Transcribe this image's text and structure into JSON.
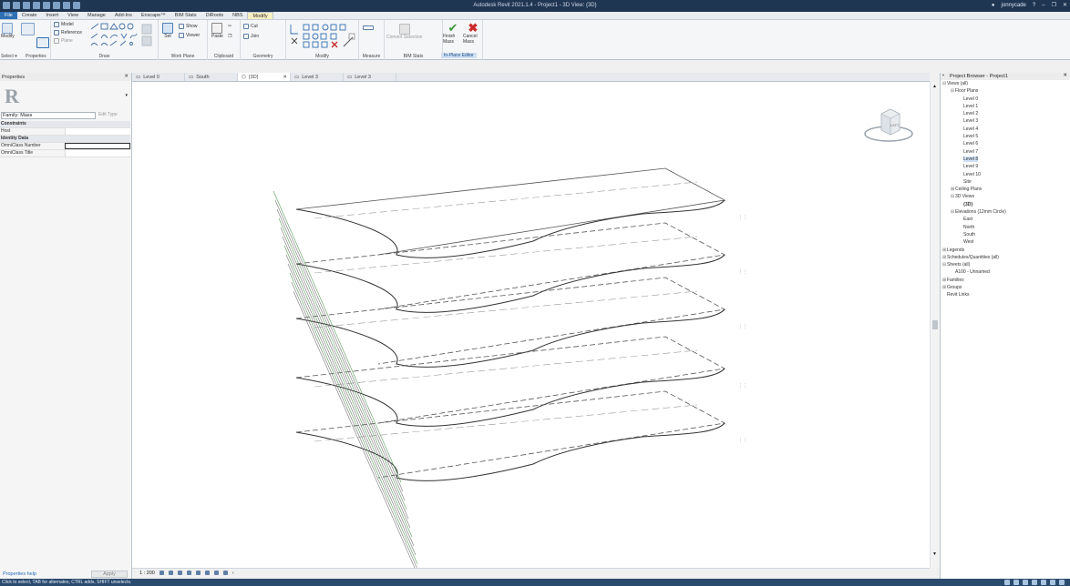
{
  "title_bar": {
    "title": "Autodesk Revit 2021.1.4 - Project1 - 3D View: {3D}",
    "user": "jonnycade"
  },
  "ribbon_tabs": [
    "File",
    "Create",
    "Insert",
    "View",
    "Manage",
    "Add-Ins",
    "Enscape™",
    "BIM Stats",
    "DiRoots",
    "NBS",
    "Modify"
  ],
  "ribbon": {
    "modify_label": "Modify",
    "select_label": "Select ▾",
    "properties_label": "Properties",
    "model_label": "Model",
    "reference_label": "Reference",
    "plane_label": "Plane",
    "draw_label": "Draw",
    "set_label": "Set",
    "show_label": "Show",
    "viewer_label": "Viewer",
    "work_plane_label": "Work Plane",
    "paste_label": "Paste",
    "clipboard_label": "Clipboard",
    "join_label": "Join",
    "cut_label": "Cut",
    "geometry_label": "Geometry",
    "modify_panel_label": "Modify",
    "measure_label": "Measure",
    "bim_stats_label": "BIM Stats",
    "convert_selection_label": "Convert Selection",
    "finish_mass_label": "Finish Mass",
    "cancel_mass_label": "Cancel Mass",
    "in_place_editor_label": "In-Place Editor"
  },
  "view_tabs": [
    {
      "label": "Level 0"
    },
    {
      "label": "South"
    },
    {
      "label": "{3D}"
    },
    {
      "label": "Level 3"
    },
    {
      "label": "Level 3"
    }
  ],
  "properties": {
    "title": "Properties",
    "family_label": "Family: Mass",
    "edit_type": "Edit Type",
    "rows": [
      {
        "k": "Constraints",
        "v": "",
        "group": true
      },
      {
        "k": "Host",
        "v": "",
        "group": false
      },
      {
        "k": "Identity Data",
        "v": "",
        "group": true
      },
      {
        "k": "OmniClass Number",
        "v": "",
        "group": false
      },
      {
        "k": "OmniClass Title",
        "v": "",
        "group": false
      }
    ],
    "help_link": "Properties help",
    "apply": "Apply"
  },
  "view_control": {
    "scale": "1 : 200"
  },
  "viewcube": {
    "face": "LEFT"
  },
  "project_browser": {
    "title": "Project Browser - Project1",
    "nodes": [
      {
        "label": "Views (all)",
        "indent": 0,
        "expander": "⊟"
      },
      {
        "label": "Floor Plans",
        "indent": 1,
        "expander": "⊟"
      },
      {
        "label": "Level 0",
        "indent": 2,
        "expander": ""
      },
      {
        "label": "Level 1",
        "indent": 2,
        "expander": ""
      },
      {
        "label": "Level 2",
        "indent": 2,
        "expander": ""
      },
      {
        "label": "Level 3",
        "indent": 2,
        "expander": ""
      },
      {
        "label": "Level 4",
        "indent": 2,
        "expander": ""
      },
      {
        "label": "Level 5",
        "indent": 2,
        "expander": ""
      },
      {
        "label": "Level 6",
        "indent": 2,
        "expander": ""
      },
      {
        "label": "Level 7",
        "indent": 2,
        "expander": ""
      },
      {
        "label": "Level 8",
        "indent": 2,
        "expander": "",
        "selected": true
      },
      {
        "label": "Level 9",
        "indent": 2,
        "expander": ""
      },
      {
        "label": "Level 10",
        "indent": 2,
        "expander": ""
      },
      {
        "label": "Site",
        "indent": 2,
        "expander": ""
      },
      {
        "label": "Ceiling Plans",
        "indent": 1,
        "expander": "⊞"
      },
      {
        "label": "3D Views",
        "indent": 1,
        "expander": "⊟"
      },
      {
        "label": "{3D}",
        "indent": 2,
        "expander": "",
        "bold": true
      },
      {
        "label": "Elevations (12mm Circle)",
        "indent": 1,
        "expander": "⊟"
      },
      {
        "label": "East",
        "indent": 2,
        "expander": ""
      },
      {
        "label": "North",
        "indent": 2,
        "expander": ""
      },
      {
        "label": "South",
        "indent": 2,
        "expander": ""
      },
      {
        "label": "West",
        "indent": 2,
        "expander": ""
      },
      {
        "label": "Legends",
        "indent": 0,
        "expander": "⊞"
      },
      {
        "label": "Schedules/Quantities (all)",
        "indent": 0,
        "expander": "⊞"
      },
      {
        "label": "Sheets (all)",
        "indent": 0,
        "expander": "⊟"
      },
      {
        "label": "A100 - Unnamed",
        "indent": 1,
        "expander": ""
      },
      {
        "label": "Families",
        "indent": 0,
        "expander": "⊞"
      },
      {
        "label": "Groups",
        "indent": 0,
        "expander": "⊞"
      },
      {
        "label": "Revit Links",
        "indent": 0,
        "expander": ""
      }
    ]
  },
  "status_bar": {
    "text": "Click to select, TAB for alternates, CTRL adds, SHIFT unselects."
  },
  "colors": {
    "title_bg": "#1f3653",
    "accent": "#2f6fb3",
    "finish_green": "#3a9a3a",
    "cancel_red": "#cc2a2a"
  }
}
